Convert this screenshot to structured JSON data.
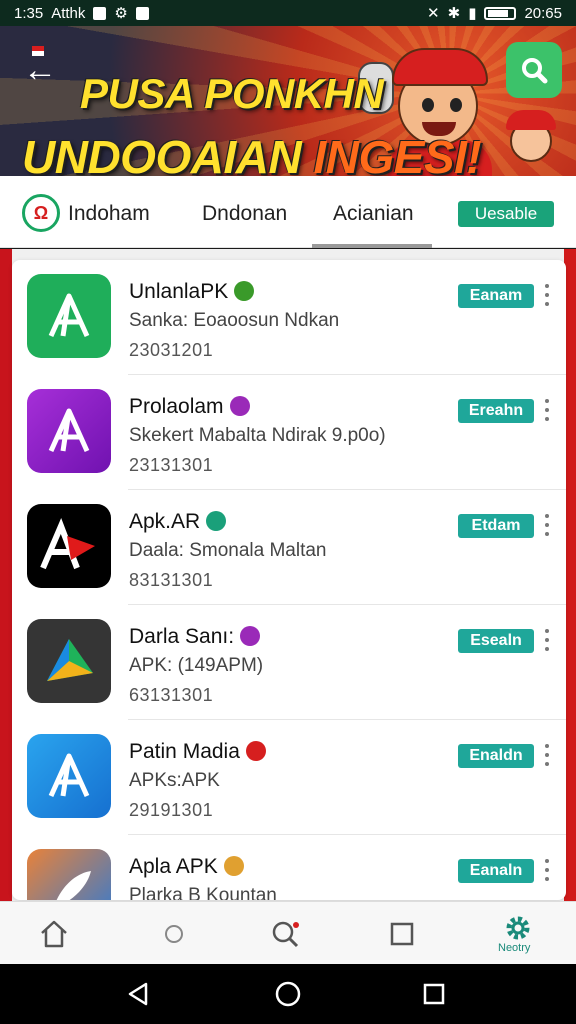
{
  "status_bar": {
    "time": "1:35",
    "carrier": "Atthk",
    "clock": "20:65"
  },
  "banner": {
    "title_line1": "PUSA PONKHN",
    "title_line2_a": "UNDOOAIAN ",
    "title_line2_b": "INGESI!"
  },
  "tabs": {
    "items": [
      {
        "label": "Indoham"
      },
      {
        "label": "Dndonan"
      },
      {
        "label": "Acianian"
      }
    ],
    "badge": "Uesable"
  },
  "apps": [
    {
      "name": "UnlanlaPK",
      "subtitle": "Sanka: Eoaoosun Ndkan",
      "date": "23031201",
      "button": "Eanam",
      "icon_color": "#1fae5a",
      "badge_color": "#3a9a2a",
      "icon": "apk-a-icon"
    },
    {
      "name": "Prolaolam",
      "subtitle": "Skekert Mabalta Ndirak 9.p0o)",
      "date": "23131301",
      "button": "Ereahn",
      "icon_color": "#8c1fc7",
      "badge_color": "#9a2ab8",
      "icon": "apk-a-icon"
    },
    {
      "name": "Apk.AR",
      "subtitle": "Daala: Smonala Maltan",
      "date": "83131301",
      "button": "Etdam",
      "icon_color": "#000000",
      "badge_color": "#1aa07a",
      "icon": "apk-ar-icon"
    },
    {
      "name": "Darla Sanı:",
      "subtitle": "APK: (149APM)",
      "date": "63131301",
      "button": "Esealn",
      "icon_color": "#3a3a3a",
      "badge_color": "#9a2ab8",
      "icon": "play-triangle-icon"
    },
    {
      "name": "Patin Madia",
      "subtitle": "APKs:APK",
      "date": "29191301",
      "button": "Enaldn",
      "icon_color": "#1a8ae0",
      "badge_color": "#d61f1f",
      "icon": "apk-a-icon"
    },
    {
      "name": "Apla APK",
      "subtitle": "Plarka B Kountan",
      "date": "",
      "button": "Eanaln",
      "icon_color": "#e0702a",
      "badge_color": "#e0a030",
      "icon": "feather-icon"
    }
  ],
  "bottom_nav": {
    "active_label": "Neotry"
  }
}
